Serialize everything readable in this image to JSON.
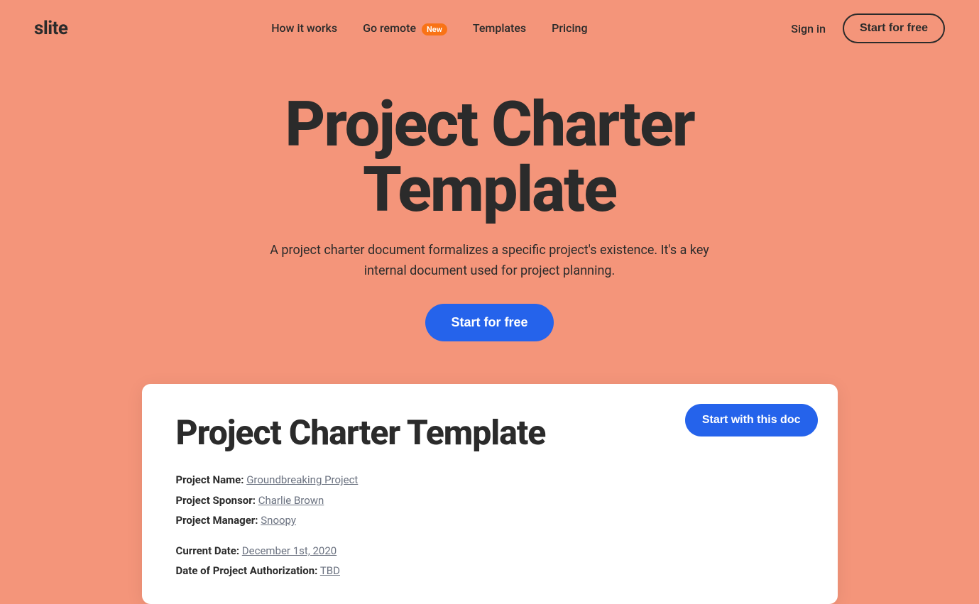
{
  "nav": {
    "logo": "slite",
    "links": [
      {
        "id": "how-it-works",
        "label": "How it works"
      },
      {
        "id": "go-remote",
        "label": "Go remote",
        "badge": "New"
      },
      {
        "id": "templates",
        "label": "Templates"
      },
      {
        "id": "pricing",
        "label": "Pricing"
      }
    ],
    "signin_label": "Sign in",
    "start_free_label": "Start for free"
  },
  "hero": {
    "title": "Project Charter Template",
    "subtitle": "A project charter document formalizes a specific project's existence. It's a key internal document used for project planning.",
    "cta_label": "Start for free"
  },
  "doc_card": {
    "cta_label": "Start with this doc",
    "title": "Project Charter Template",
    "fields": [
      {
        "label": "Project Name:",
        "value": "Groundbreaking Project"
      },
      {
        "label": "Project Sponsor:",
        "value": "Charlie Brown"
      },
      {
        "label": "Project Manager:",
        "value": "Snoopy"
      }
    ],
    "fields2": [
      {
        "label": "Current Date:",
        "value": "December 1st, 2020"
      },
      {
        "label": "Date of Project Authorization:",
        "value": "TBD"
      }
    ]
  }
}
